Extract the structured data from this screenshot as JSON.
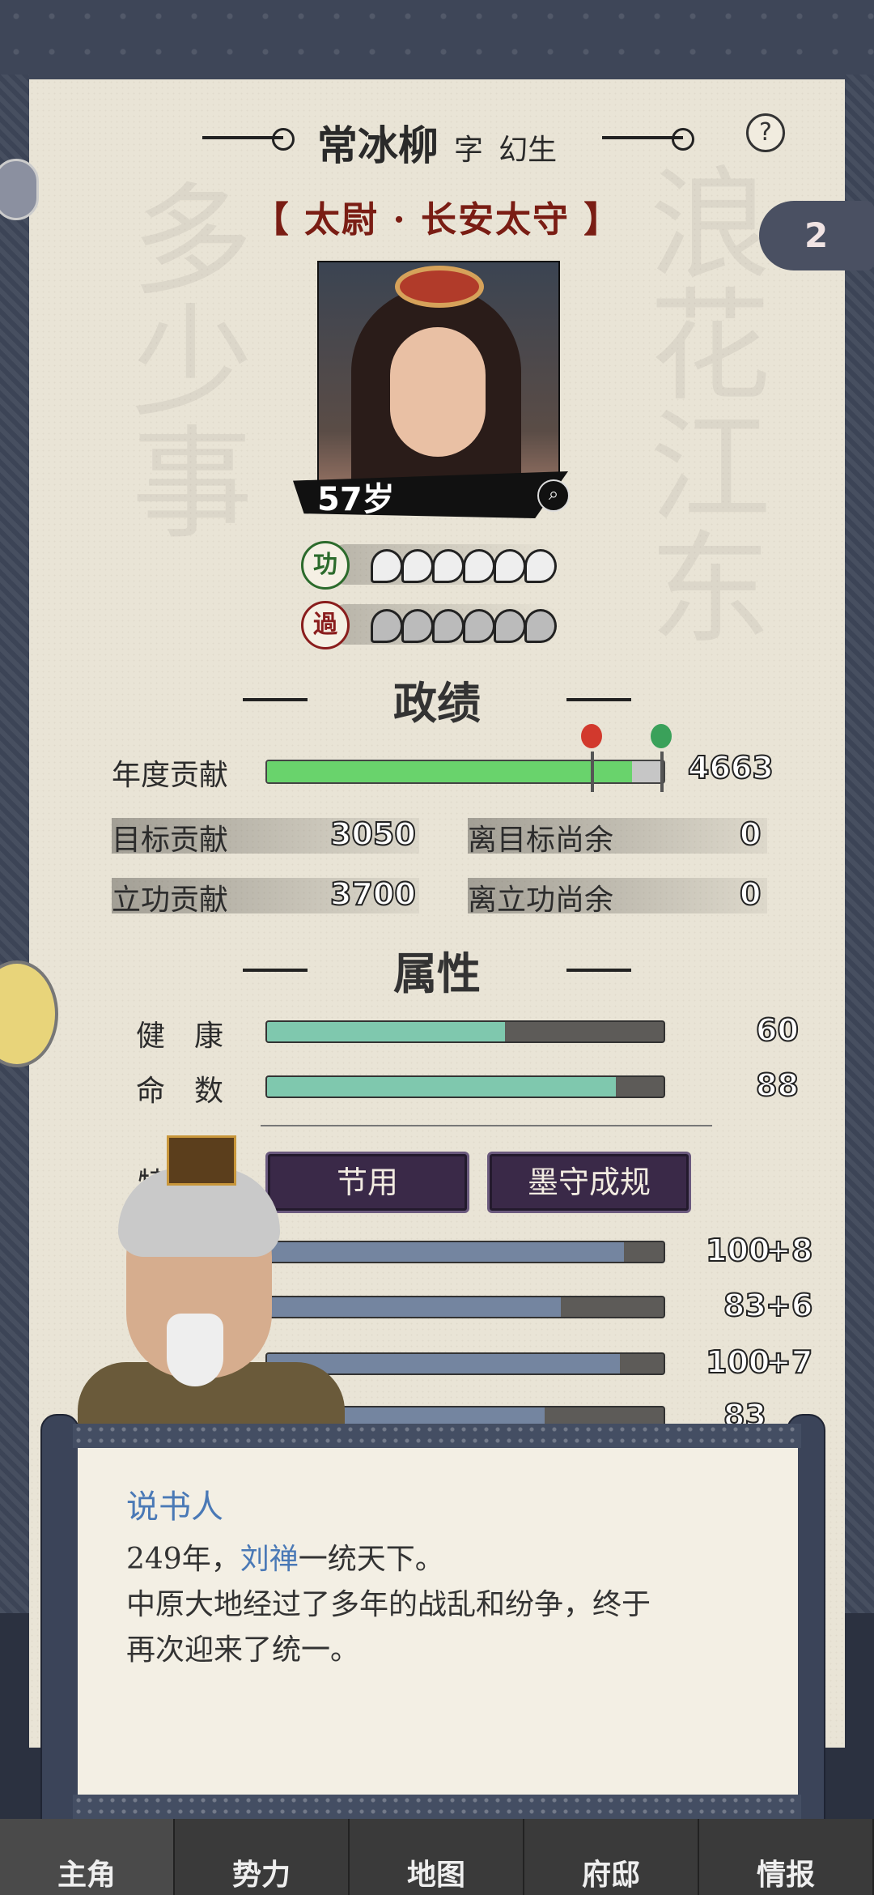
{
  "character": {
    "name": "常冰柳",
    "courtesy_prefix": "字",
    "courtesy_name": "幻生",
    "title": "【 太尉 · 长安太守 】",
    "age": "57岁",
    "merit_icon": "功",
    "demerit_icon": "過"
  },
  "badge_count": "2",
  "help_label": "?",
  "performance": {
    "section_title": "政绩",
    "annual_label": "年度贡献",
    "annual_value": "4663",
    "annual_fraction": 0.92,
    "target_label": "目标贡献",
    "target_value": "3050",
    "target_remaining_label": "离目标尚余",
    "target_remaining_value": "0",
    "merit_label": "立功贡献",
    "merit_value": "3700",
    "merit_remaining_label": "离立功尚余",
    "merit_remaining_value": "0"
  },
  "attributes": {
    "section_title": "属性",
    "health_label": "健　康",
    "health_value": "60",
    "health_fraction": 0.6,
    "fate_label": "命　数",
    "fate_value": "88",
    "fate_fraction": 0.88,
    "traits_label": "特　长",
    "traits": [
      "节用",
      "墨守成规"
    ],
    "ability_rows": [
      {
        "value": "100",
        "bonus": "+8",
        "fraction": 0.9
      },
      {
        "value": "83",
        "bonus": "+6",
        "fraction": 0.74
      },
      {
        "value": "100",
        "bonus": "+7",
        "fraction": 0.89
      },
      {
        "value": "83",
        "bonus": "",
        "fraction": 0.7
      }
    ]
  },
  "dialog": {
    "speaker": "说书人",
    "line1_pre": "249年，",
    "line1_name": "刘禅",
    "line1_post": "一统天下。",
    "line2": "中原大地经过了多年的战乱和纷争，终于",
    "line3": "再次迎来了统一。"
  },
  "nav": {
    "items": [
      "主角",
      "势力",
      "地图",
      "府邸",
      "情报"
    ],
    "active": 0
  }
}
